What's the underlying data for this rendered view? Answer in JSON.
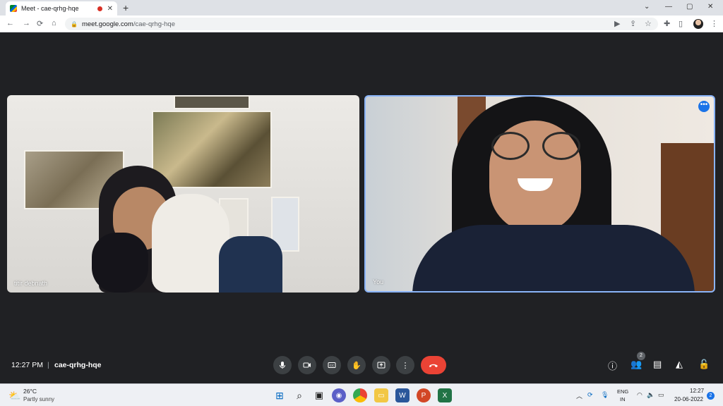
{
  "browser": {
    "tab_title": "Meet - cae-qrhg-hqe",
    "tab_close": "✕",
    "new_tab": "+",
    "url_host": "meet.google.com",
    "url_path": "/cae-qrhg-hqe"
  },
  "participants": [
    {
      "name": "titir debnath"
    },
    {
      "name": "You"
    }
  ],
  "bottom_bar": {
    "time": "12:27 PM",
    "separator": "|",
    "meeting_code": "cae-qrhg-hqe",
    "participant_count": "2"
  },
  "taskbar": {
    "weather_temp": "26°C",
    "weather_desc": "Partly sunny",
    "lang_top": "ENG",
    "lang_bottom": "IN",
    "clock_time": "12:27",
    "clock_date": "20-06-2022",
    "notification_count": "2"
  },
  "colors": {
    "meet_background": "#202124",
    "control_button": "#3c4043",
    "hangup_red": "#ea4335",
    "active_border": "#8ab4f8"
  }
}
